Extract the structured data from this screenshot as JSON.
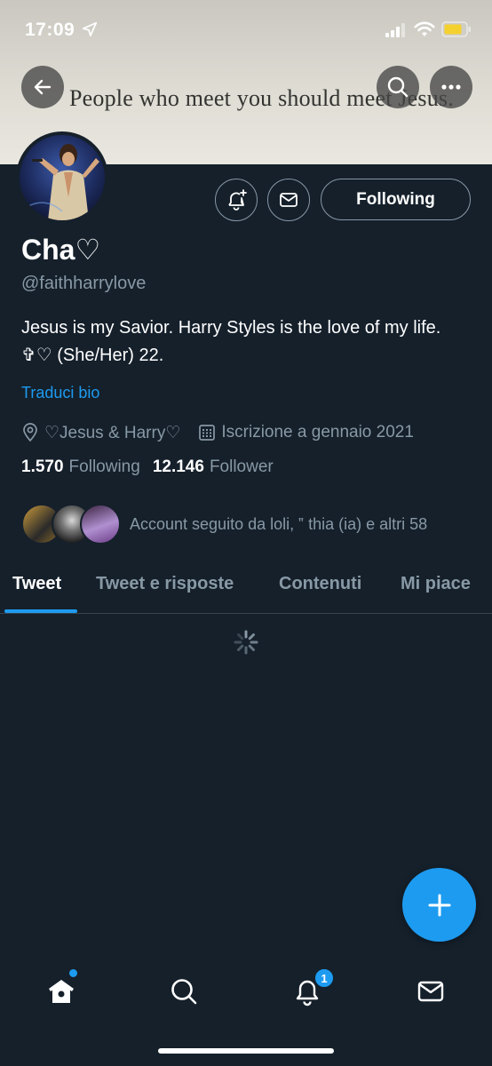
{
  "status_bar": {
    "time": "17:09",
    "location_icon": "location-arrow-icon",
    "signal_icon": "cellular-signal-icon",
    "wifi_icon": "wifi-icon",
    "battery_icon": "battery-icon",
    "battery_color": "#f5d12f"
  },
  "header": {
    "banner_text": "People who meet you should meet Jesus.",
    "back_icon": "back-arrow-icon",
    "search_icon": "search-icon",
    "more_icon": "more-icon"
  },
  "profile": {
    "display_name": "Cha♡",
    "handle": "@faithharrylove",
    "bio": "Jesus is my Savior. Harry Styles is the love of my life. ✞♡ (She/Her) 22.",
    "translate_label": "Traduci bio",
    "location": "♡Jesus & Harry♡",
    "joined": "Iscrizione a gennaio 2021",
    "following_count": "1.570",
    "following_label": "Following",
    "followers_count": "12.146",
    "followers_label": "Follower",
    "followed_by_text": "Account seguito da loli, ‟ thia (ia) e altri 58"
  },
  "actions": {
    "notify_icon": "bell-plus-icon",
    "message_icon": "envelope-icon",
    "following_button": "Following"
  },
  "tabs": [
    {
      "label": "Tweet",
      "active": true
    },
    {
      "label": "Tweet e risposte",
      "active": false
    },
    {
      "label": "Contenuti",
      "active": false
    },
    {
      "label": "Mi piace",
      "active": false
    }
  ],
  "bottom_nav": {
    "items": [
      "home-icon",
      "search-icon",
      "notifications-icon",
      "messages-icon"
    ],
    "notification_badge": "1"
  },
  "colors": {
    "background": "#15202b",
    "accent": "#1d9bf0",
    "secondary_text": "#8899a6"
  }
}
